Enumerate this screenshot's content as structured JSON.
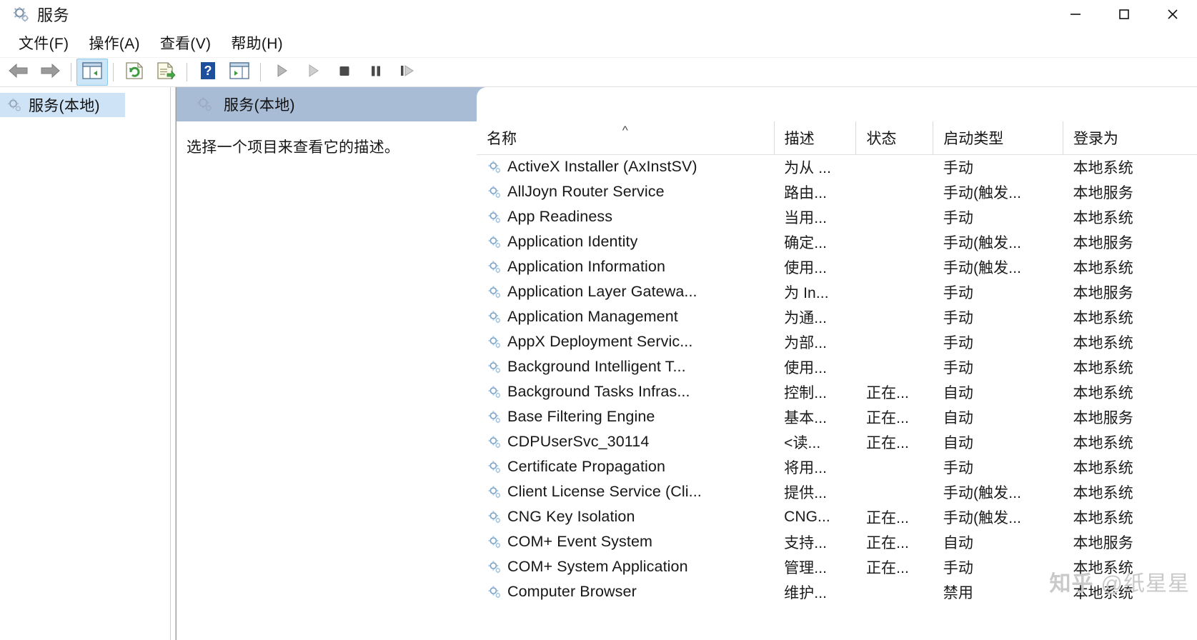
{
  "window": {
    "title": "服务",
    "icon": "services-gear-icon",
    "minimize_label": "最小化",
    "maximize_label": "最大化",
    "close_label": "关闭"
  },
  "menubar": {
    "items": [
      {
        "label": "文件(F)",
        "name": "menu-file"
      },
      {
        "label": "操作(A)",
        "name": "menu-action"
      },
      {
        "label": "查看(V)",
        "name": "menu-view"
      },
      {
        "label": "帮助(H)",
        "name": "menu-help"
      }
    ]
  },
  "toolbar": {
    "buttons": [
      {
        "name": "back-button",
        "icon": "back-arrow-icon",
        "active": false
      },
      {
        "name": "forward-button",
        "icon": "forward-arrow-icon",
        "active": false
      },
      {
        "name": "show-console-tree-button",
        "icon": "console-tree-icon",
        "active": true
      },
      {
        "name": "refresh-button",
        "icon": "refresh-icon",
        "active": false
      },
      {
        "name": "export-list-button",
        "icon": "export-list-icon",
        "active": false
      },
      {
        "name": "help-button",
        "icon": "help-question-icon",
        "active": false
      },
      {
        "name": "show-action-pane-button",
        "icon": "action-pane-icon",
        "active": false
      },
      {
        "name": "start-service-button",
        "icon": "play-icon",
        "active": false
      },
      {
        "name": "resume-service-button",
        "icon": "play-outline-icon",
        "active": false
      },
      {
        "name": "stop-service-button",
        "icon": "stop-square-icon",
        "active": false
      },
      {
        "name": "pause-service-button",
        "icon": "pause-bars-icon",
        "active": false
      },
      {
        "name": "restart-service-button",
        "icon": "restart-icon",
        "active": false
      }
    ]
  },
  "tree": {
    "items": [
      {
        "label": "服务(本地)",
        "icon": "services-gear-icon",
        "selected": true
      }
    ]
  },
  "pane": {
    "banner_title": "服务(本地)",
    "banner_icon": "services-gear-icon",
    "detail_hint": "选择一个项目来查看它的描述。"
  },
  "table": {
    "columns": [
      {
        "label": "名称",
        "key": "name",
        "sort": "asc"
      },
      {
        "label": "描述",
        "key": "description",
        "sort": ""
      },
      {
        "label": "状态",
        "key": "status",
        "sort": ""
      },
      {
        "label": "启动类型",
        "key": "startup",
        "sort": ""
      },
      {
        "label": "登录为",
        "key": "logon",
        "sort": ""
      }
    ],
    "rows": [
      {
        "name": "ActiveX Installer (AxInstSV)",
        "description": "为从 ...",
        "status": "",
        "startup": "手动",
        "logon": "本地系统"
      },
      {
        "name": "AllJoyn Router Service",
        "description": "路由...",
        "status": "",
        "startup": "手动(触发...",
        "logon": "本地服务"
      },
      {
        "name": "App Readiness",
        "description": "当用...",
        "status": "",
        "startup": "手动",
        "logon": "本地系统"
      },
      {
        "name": "Application Identity",
        "description": "确定...",
        "status": "",
        "startup": "手动(触发...",
        "logon": "本地服务"
      },
      {
        "name": "Application Information",
        "description": "使用...",
        "status": "",
        "startup": "手动(触发...",
        "logon": "本地系统"
      },
      {
        "name": "Application Layer Gatewa...",
        "description": "为 In...",
        "status": "",
        "startup": "手动",
        "logon": "本地服务"
      },
      {
        "name": "Application Management",
        "description": "为通...",
        "status": "",
        "startup": "手动",
        "logon": "本地系统"
      },
      {
        "name": "AppX Deployment Servic...",
        "description": "为部...",
        "status": "",
        "startup": "手动",
        "logon": "本地系统"
      },
      {
        "name": "Background Intelligent T...",
        "description": "使用...",
        "status": "",
        "startup": "手动",
        "logon": "本地系统"
      },
      {
        "name": "Background Tasks Infras...",
        "description": "控制...",
        "status": "正在...",
        "startup": "自动",
        "logon": "本地系统"
      },
      {
        "name": "Base Filtering Engine",
        "description": "基本...",
        "status": "正在...",
        "startup": "自动",
        "logon": "本地服务"
      },
      {
        "name": "CDPUserSvc_30114",
        "description": "<读...",
        "status": "正在...",
        "startup": "自动",
        "logon": "本地系统"
      },
      {
        "name": "Certificate Propagation",
        "description": "将用...",
        "status": "",
        "startup": "手动",
        "logon": "本地系统"
      },
      {
        "name": "Client License Service (Cli...",
        "description": "提供...",
        "status": "",
        "startup": "手动(触发...",
        "logon": "本地系统"
      },
      {
        "name": "CNG Key Isolation",
        "description": "CNG...",
        "status": "正在...",
        "startup": "手动(触发...",
        "logon": "本地系统"
      },
      {
        "name": "COM+ Event System",
        "description": "支持...",
        "status": "正在...",
        "startup": "自动",
        "logon": "本地服务"
      },
      {
        "name": "COM+ System Application",
        "description": "管理...",
        "status": "正在...",
        "startup": "手动",
        "logon": "本地系统"
      },
      {
        "name": "Computer Browser",
        "description": "维护...",
        "status": "",
        "startup": "禁用",
        "logon": "本地系统"
      }
    ]
  },
  "watermark": {
    "logo": "知乎",
    "handle": "@纸星星"
  }
}
